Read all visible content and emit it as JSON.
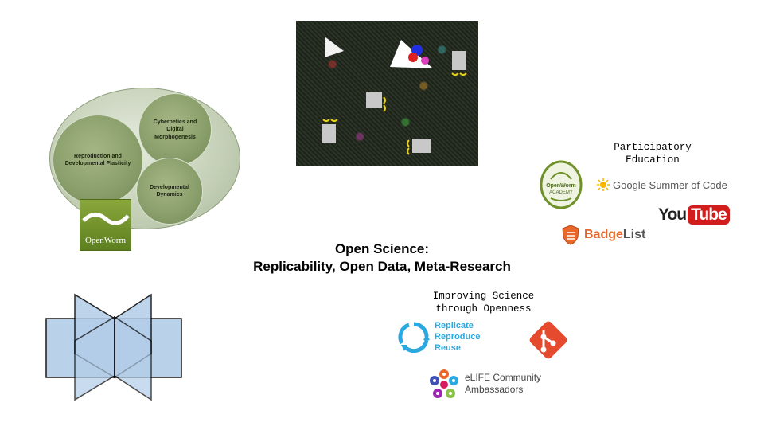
{
  "venn": {
    "circles": [
      "Reproduction and Developmental Plasticity",
      "Cybernetics and Digital Morphogenesis",
      "Developmental Dynamics"
    ]
  },
  "openworm_logo_text": "OpenWorm",
  "headline": {
    "line1": "Open Science:",
    "line2": "Replicability, Open Data, Meta-Research"
  },
  "participatory": {
    "title_line1": "Participatory",
    "title_line2": "Education",
    "academy_logo_text": "OpenWorm ACADEMY",
    "gsoc_text": "Google Summer of Code",
    "youtube_you": "You",
    "youtube_tube": "Tube",
    "badgelist_a": "Badge",
    "badgelist_b": "List"
  },
  "improving": {
    "title_line1": "Improving Science",
    "title_line2": "through Openness",
    "rrr": [
      "Replicate",
      "Reproduce",
      "Reuse"
    ],
    "elife_line1": "eLIFE Community",
    "elife_line2": "Ambassadors"
  },
  "colors": {
    "venn_green": "#8ba06c",
    "openworm_green": "#6f9128",
    "polygon_blue": "#b3cde8",
    "git_orange": "#e64a2e",
    "rrr_blue": "#2aa8df",
    "youtube_red": "#d21d1d",
    "badgelist_orange": "#e8672a"
  },
  "icons": [
    "openworm-logo",
    "openworm-academy-logo",
    "gsoc-sun-icon",
    "youtube-logo",
    "badgelist-shield-icon",
    "rrr-cycle-icon",
    "git-icon",
    "elife-ambassadors-icon"
  ]
}
